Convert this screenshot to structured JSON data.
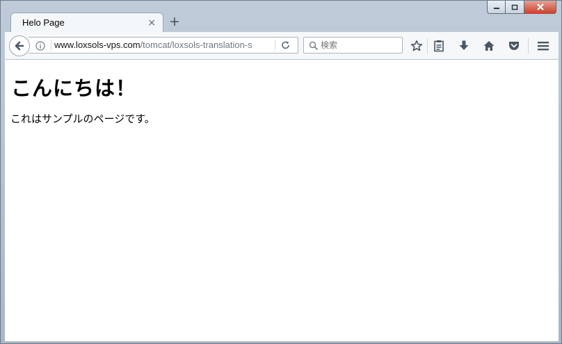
{
  "tab": {
    "title": "Helo Page",
    "close_symbol": "×"
  },
  "new_tab_symbol": "+",
  "address_bar": {
    "url_host": "www.loxsols-vps.com",
    "url_path": "/tomcat/loxsols-translation-s"
  },
  "search": {
    "placeholder": "検索"
  },
  "page": {
    "heading": "こんにちは！",
    "paragraph": "これはサンプルのページです。"
  },
  "icons": {
    "back": "back-arrow-icon",
    "info": "info-icon",
    "reload": "reload-icon",
    "search": "search-icon",
    "bookmark": "star-icon",
    "reading_list": "clipboard-icon",
    "downloads": "download-arrow-icon",
    "home": "home-icon",
    "pocket": "pocket-icon",
    "menu": "hamburger-menu-icon"
  },
  "colors": {
    "window_frame": "#a9b7c6",
    "close_button": "#c8432c",
    "toolbar_bg": "#f5f7f9",
    "icon": "#4a5764"
  }
}
